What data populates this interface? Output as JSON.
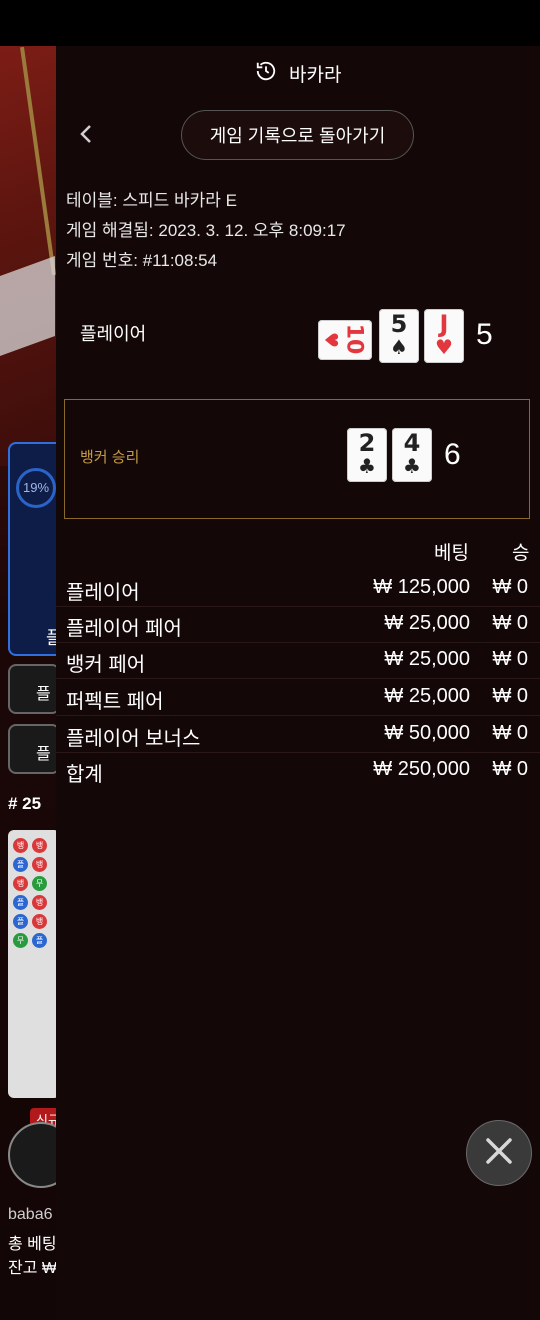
{
  "modal": {
    "title": "바카라",
    "back_label": "게임 기록으로 돌아가기",
    "table_line": "테이블: 스피드 바카라 E",
    "resolved_line": "게임 해결됨: 2023. 3. 12. 오후 8:09:17",
    "game_number_line": "게임 번호: #11:08:54"
  },
  "player_hand": {
    "label": "플레이어",
    "score": "5",
    "cards": [
      {
        "rank": "10",
        "suit": "♥",
        "color": "#e2373f",
        "sideways": true
      },
      {
        "rank": "5",
        "suit": "♠",
        "color": "#222222",
        "sideways": false
      },
      {
        "rank": "J",
        "suit": "♥",
        "color": "#e2373f",
        "sideways": false
      }
    ]
  },
  "banker_hand": {
    "label": "뱅커 승리",
    "score": "6",
    "cards": [
      {
        "rank": "2",
        "suit": "♣",
        "color": "#222222"
      },
      {
        "rank": "4",
        "suit": "♣",
        "color": "#222222"
      }
    ]
  },
  "bets": {
    "header_bet": "베팅",
    "header_win": "승",
    "rows": [
      {
        "name": "플레이어",
        "amount": "₩ 125,000",
        "win": "₩ 0"
      },
      {
        "name": "플레이어 페어",
        "amount": "₩ 25,000",
        "win": "₩ 0"
      },
      {
        "name": "뱅커 페어",
        "amount": "₩ 25,000",
        "win": "₩ 0"
      },
      {
        "name": "퍼펙트 페어",
        "amount": "₩ 25,000",
        "win": "₩ 0"
      },
      {
        "name": "플레이어 보너스",
        "amount": "₩ 50,000",
        "win": "₩ 0"
      },
      {
        "name": "합계",
        "amount": "₩ 250,000",
        "win": "₩ 0"
      }
    ]
  },
  "background": {
    "percent": "19%",
    "tile_label": "플",
    "btn1": "플",
    "btn2": "플",
    "round": "# 25",
    "new_badge": "신규",
    "user_text": "baba6",
    "total_bet_label": "총 베팅",
    "balance_label": "잔고 ₩"
  },
  "colors": {
    "accent_gold": "#c49a44",
    "panel_bg": "#140707",
    "red_card": "#e2373f"
  }
}
